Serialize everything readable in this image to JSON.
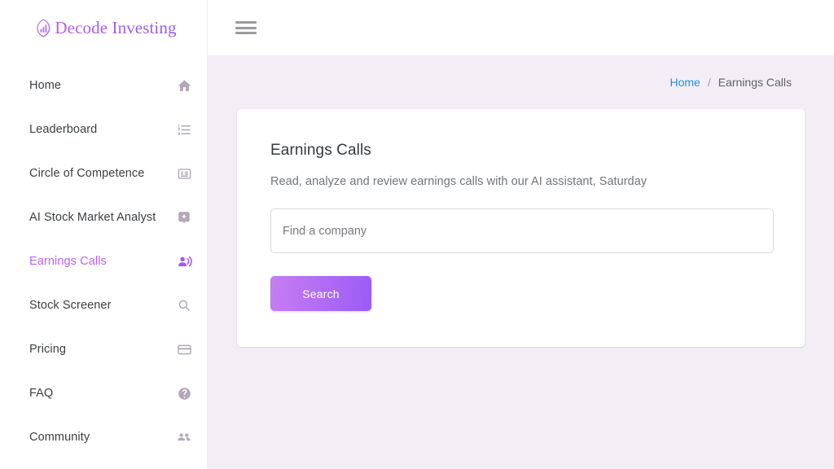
{
  "brand": {
    "name": "Decode Investing",
    "icon": "chart-leaf-logo-icon"
  },
  "sidebar": {
    "items": [
      {
        "label": "Home",
        "icon": "home-icon",
        "active": false
      },
      {
        "label": "Leaderboard",
        "icon": "numbered-list-icon",
        "active": false
      },
      {
        "label": "Circle of Competence",
        "icon": "article-list-icon",
        "active": false
      },
      {
        "label": "AI Stock Market Analyst",
        "icon": "sparkle-badge-icon",
        "active": false
      },
      {
        "label": "Earnings Calls",
        "icon": "voice-over-icon",
        "active": true
      },
      {
        "label": "Stock Screener",
        "icon": "search-icon",
        "active": false
      },
      {
        "label": "Pricing",
        "icon": "credit-card-icon",
        "active": false
      },
      {
        "label": "FAQ",
        "icon": "help-circle-icon",
        "active": false
      },
      {
        "label": "Community",
        "icon": "people-group-icon",
        "active": false
      }
    ]
  },
  "topbar": {
    "menu_icon": "hamburger-menu-icon"
  },
  "breadcrumb": {
    "home": "Home",
    "separator": "/",
    "current": "Earnings Calls"
  },
  "main": {
    "title": "Earnings Calls",
    "subtitle": "Read, analyze and review earnings calls with our AI assistant, Saturday",
    "search": {
      "value": "",
      "placeholder": "Find a company",
      "button_label": "Search"
    }
  },
  "colors": {
    "accent_purple": "#bb63ef",
    "button_gradient_start": "#c77df2",
    "button_gradient_end": "#9b5cf6",
    "page_background": "#f3eef5",
    "link_blue": "#1f90e0"
  }
}
